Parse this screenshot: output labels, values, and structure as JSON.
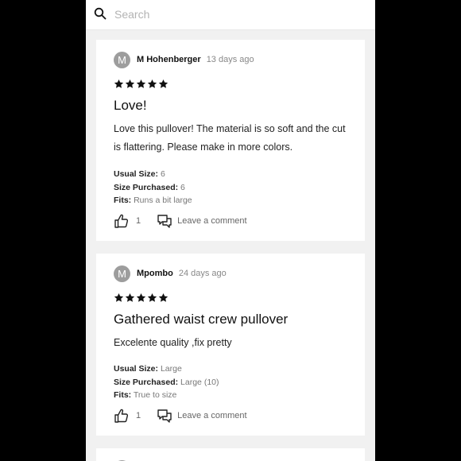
{
  "search": {
    "placeholder": "Search"
  },
  "reviews": [
    {
      "avatar_initial": "M",
      "username": "M Hohenberger",
      "time": "13 days ago",
      "stars": 5,
      "title": "Love!",
      "body": "Love this pullover! The material is so soft and the cut is flattering. Please make in more colors.",
      "usual_size_label": "Usual Size:",
      "usual_size": "6",
      "size_purchased_label": "Size Purchased:",
      "size_purchased": "6",
      "fits_label": "Fits:",
      "fits": "Runs a bit large",
      "likes": "1",
      "comment_label": "Leave a comment"
    },
    {
      "avatar_initial": "M",
      "username": "Mpombo",
      "time": "24 days ago",
      "stars": 5,
      "title": "Gathered waist crew pullover",
      "body": "Excelente quality ,fix pretty",
      "usual_size_label": "Usual Size:",
      "usual_size": "Large",
      "size_purchased_label": "Size Purchased:",
      "size_purchased": "Large (10)",
      "fits_label": "Fits:",
      "fits": "True to size",
      "likes": "1",
      "comment_label": "Leave a comment"
    }
  ],
  "colors": {
    "background": "#000000",
    "surface": "#f1f1f1",
    "card": "#ffffff",
    "avatar": "#9d9d9d"
  }
}
